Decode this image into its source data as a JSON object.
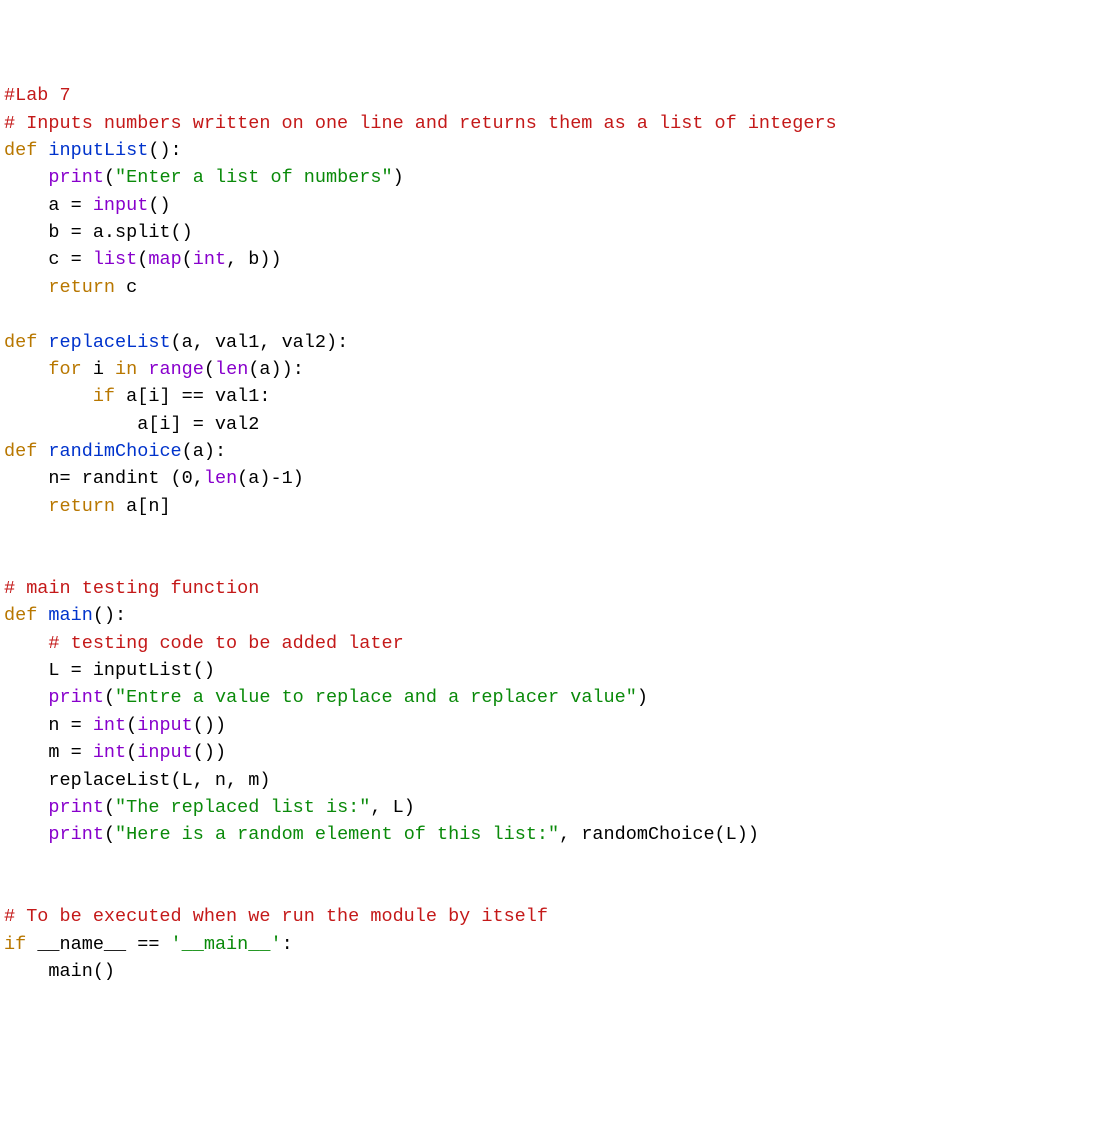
{
  "code": {
    "lines": [
      [
        {
          "cls": "c-comment",
          "t": "#Lab 7"
        }
      ],
      [
        {
          "cls": "c-comment",
          "t": "# Inputs numbers written on one line and returns them as a list of integers"
        }
      ],
      [
        {
          "cls": "c-keyword",
          "t": "def"
        },
        {
          "t": " "
        },
        {
          "cls": "c-defname",
          "t": "inputList"
        },
        {
          "t": "():"
        }
      ],
      [
        {
          "t": "    "
        },
        {
          "cls": "c-print",
          "t": "print"
        },
        {
          "t": "("
        },
        {
          "cls": "c-string",
          "t": "\"Enter a list of numbers\""
        },
        {
          "t": ")"
        }
      ],
      [
        {
          "t": "    a = "
        },
        {
          "cls": "c-builtin",
          "t": "input"
        },
        {
          "t": "()"
        }
      ],
      [
        {
          "t": "    b = a.split()"
        }
      ],
      [
        {
          "t": "    c = "
        },
        {
          "cls": "c-builtin",
          "t": "list"
        },
        {
          "t": "("
        },
        {
          "cls": "c-builtin",
          "t": "map"
        },
        {
          "t": "("
        },
        {
          "cls": "c-builtin",
          "t": "int"
        },
        {
          "t": ", b))"
        }
      ],
      [
        {
          "t": "    "
        },
        {
          "cls": "c-keyword",
          "t": "return"
        },
        {
          "t": " c"
        }
      ],
      [
        {
          "t": ""
        }
      ],
      [
        {
          "cls": "c-keyword",
          "t": "def"
        },
        {
          "t": " "
        },
        {
          "cls": "c-defname",
          "t": "replaceList"
        },
        {
          "t": "(a, val1, val2):"
        }
      ],
      [
        {
          "t": "    "
        },
        {
          "cls": "c-keyword",
          "t": "for"
        },
        {
          "t": " i "
        },
        {
          "cls": "c-keyword",
          "t": "in"
        },
        {
          "t": " "
        },
        {
          "cls": "c-builtin",
          "t": "range"
        },
        {
          "t": "("
        },
        {
          "cls": "c-builtin",
          "t": "len"
        },
        {
          "t": "(a)):"
        }
      ],
      [
        {
          "t": "        "
        },
        {
          "cls": "c-keyword",
          "t": "if"
        },
        {
          "t": " a[i] == val1:"
        }
      ],
      [
        {
          "t": "            a[i] = val2"
        }
      ],
      [
        {
          "cls": "c-keyword",
          "t": "def"
        },
        {
          "t": " "
        },
        {
          "cls": "c-defname",
          "t": "randimChoice"
        },
        {
          "t": "(a):"
        }
      ],
      [
        {
          "t": "    n= randint ("
        },
        {
          "cls": "c-num",
          "t": "0"
        },
        {
          "t": ","
        },
        {
          "cls": "c-builtin",
          "t": "len"
        },
        {
          "t": "(a)-"
        },
        {
          "cls": "c-num",
          "t": "1"
        },
        {
          "t": ")"
        }
      ],
      [
        {
          "t": "    "
        },
        {
          "cls": "c-keyword",
          "t": "return"
        },
        {
          "t": " a[n]"
        }
      ],
      [
        {
          "t": ""
        }
      ],
      [
        {
          "t": ""
        }
      ],
      [
        {
          "cls": "c-comment",
          "t": "# main testing function"
        }
      ],
      [
        {
          "cls": "c-keyword",
          "t": "def"
        },
        {
          "t": " "
        },
        {
          "cls": "c-defname",
          "t": "main"
        },
        {
          "t": "():"
        }
      ],
      [
        {
          "t": "    "
        },
        {
          "cls": "c-comment",
          "t": "# testing code to be added later"
        }
      ],
      [
        {
          "t": "    L = inputList()"
        }
      ],
      [
        {
          "t": "    "
        },
        {
          "cls": "c-print",
          "t": "print"
        },
        {
          "t": "("
        },
        {
          "cls": "c-string",
          "t": "\"Entre a value to replace and a replacer value\""
        },
        {
          "t": ")"
        }
      ],
      [
        {
          "t": "    n = "
        },
        {
          "cls": "c-builtin",
          "t": "int"
        },
        {
          "t": "("
        },
        {
          "cls": "c-builtin",
          "t": "input"
        },
        {
          "t": "())"
        }
      ],
      [
        {
          "t": "    m = "
        },
        {
          "cls": "c-builtin",
          "t": "int"
        },
        {
          "t": "("
        },
        {
          "cls": "c-builtin",
          "t": "input"
        },
        {
          "t": "())"
        }
      ],
      [
        {
          "t": "    replaceList(L, n, m)"
        }
      ],
      [
        {
          "t": "    "
        },
        {
          "cls": "c-print",
          "t": "print"
        },
        {
          "t": "("
        },
        {
          "cls": "c-string",
          "t": "\"The replaced list is:\""
        },
        {
          "t": ", L)"
        }
      ],
      [
        {
          "t": "    "
        },
        {
          "cls": "c-print",
          "t": "print"
        },
        {
          "t": "("
        },
        {
          "cls": "c-string",
          "t": "\"Here is a random element of this list:\""
        },
        {
          "t": ", randomChoice(L))"
        }
      ],
      [
        {
          "t": ""
        }
      ],
      [
        {
          "t": ""
        }
      ],
      [
        {
          "cls": "c-comment",
          "t": "# To be executed when we run the module by itself"
        }
      ],
      [
        {
          "cls": "c-keyword",
          "t": "if"
        },
        {
          "t": " __name__ == "
        },
        {
          "cls": "c-string",
          "t": "'__main__'"
        },
        {
          "t": ":"
        }
      ],
      [
        {
          "t": "    main()"
        }
      ]
    ]
  }
}
